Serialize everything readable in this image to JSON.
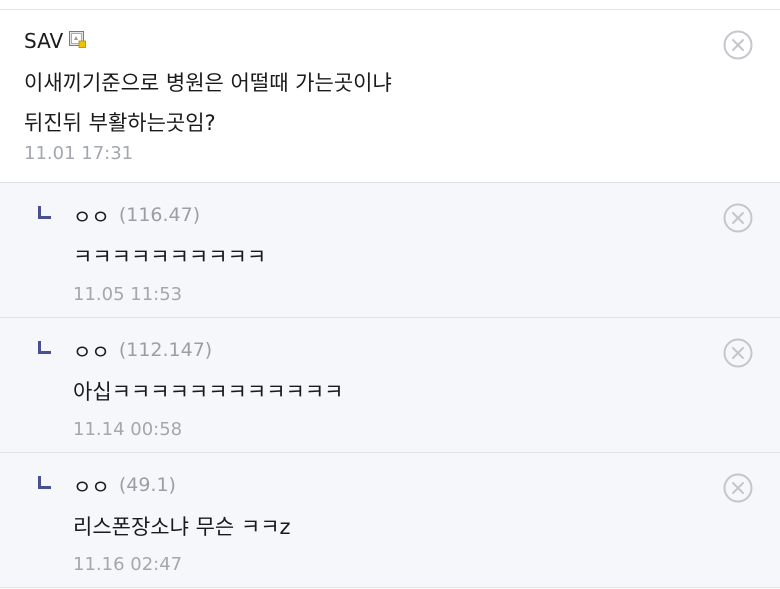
{
  "comments": [
    {
      "type": "main",
      "author": "SAV",
      "ip": "",
      "text_lines": [
        "이새끼기준으로 병원은 어떨때 가는곳이냐",
        "뒤진뒤 부활하는곳임?"
      ],
      "time": "11.01 17:31"
    },
    {
      "type": "reply",
      "author": "ㅇㅇ",
      "ip": "(116.47)",
      "text": "ㅋㅋㅋㅋㅋㅋㅋㅋㅋㅋ",
      "time": "11.05 11:53"
    },
    {
      "type": "reply",
      "author": "ㅇㅇ",
      "ip": "(112.147)",
      "text": "아십ㅋㅋㅋㅋㅋㅋㅋㅋㅋㅋㅋㅋ",
      "time": "11.14 00:58"
    },
    {
      "type": "reply",
      "author": "ㅇㅇ",
      "ip": "(49.1)",
      "text": "리스폰장소냐 무슨 ㅋㅋz",
      "time": "11.16 02:47"
    }
  ],
  "icons": {
    "badge": "fixed-nick-badge-icon",
    "delete": "close-circle-icon",
    "reply": "reply-arrow-icon"
  },
  "colors": {
    "reply_arrow": "#4a4f8f",
    "reply_bg": "#f6f7fa",
    "meta_text": "#a4a7ae"
  }
}
